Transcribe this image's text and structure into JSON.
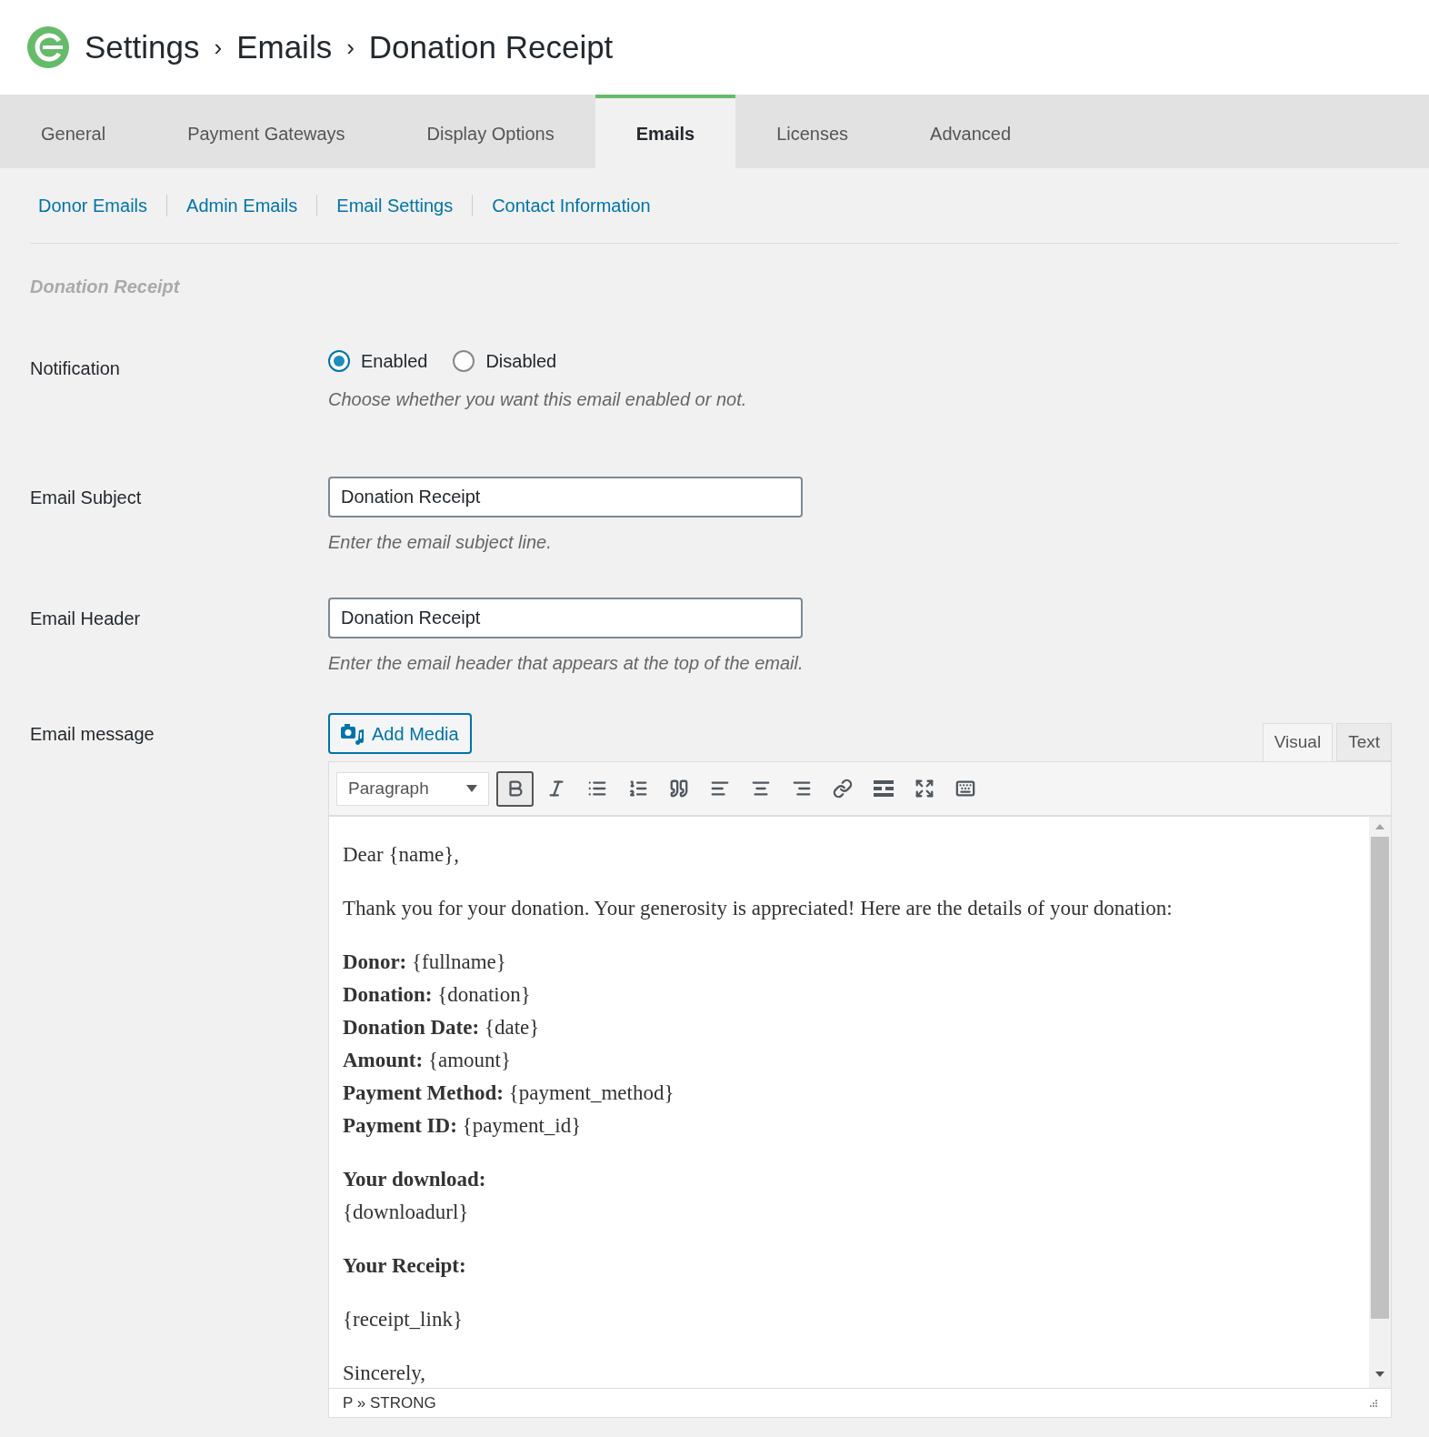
{
  "breadcrumb": [
    "Settings",
    "Emails",
    "Donation Receipt"
  ],
  "breadcrumb_separator": "›",
  "tabs": [
    {
      "label": "General",
      "selected": false
    },
    {
      "label": "Payment Gateways",
      "selected": false
    },
    {
      "label": "Display Options",
      "selected": false
    },
    {
      "label": "Emails",
      "selected": true
    },
    {
      "label": "Licenses",
      "selected": false
    },
    {
      "label": "Advanced",
      "selected": false
    }
  ],
  "subnav": [
    "Donor Emails",
    "Admin Emails",
    "Email Settings",
    "Contact Information"
  ],
  "section_title": "Donation Receipt",
  "notification": {
    "label": "Notification",
    "options": [
      {
        "label": "Enabled",
        "selected": true
      },
      {
        "label": "Disabled",
        "selected": false
      }
    ],
    "help": "Choose whether you want this email enabled or not."
  },
  "subject": {
    "label": "Email Subject",
    "value": "Donation Receipt",
    "help": "Enter the email subject line."
  },
  "header": {
    "label": "Email Header",
    "value": "Donation Receipt",
    "help": "Enter the email header that appears at the top of the email."
  },
  "message": {
    "label": "Email message",
    "add_media": "Add Media",
    "modes": [
      {
        "label": "Visual",
        "selected": true
      },
      {
        "label": "Text",
        "selected": false
      }
    ],
    "format": "Paragraph",
    "toolbar": [
      {
        "pressed": true
      },
      {
        "pressed": false
      },
      {
        "pressed": false
      },
      {
        "pressed": false
      },
      {
        "pressed": false
      },
      {
        "pressed": false
      },
      {
        "pressed": false
      },
      {
        "pressed": false
      },
      {
        "pressed": false
      },
      {
        "pressed": false
      },
      {
        "pressed": false
      },
      {
        "pressed": false
      }
    ],
    "paragraphs": [
      [
        "Dear {name},"
      ],
      [
        "Thank you for your donation. Your generosity is appreciated! Here are the details of your donation:"
      ],
      [
        "**Donor:** {fullname}",
        "**Donation:** {donation}",
        "**Donation Date:** {date}",
        "**Amount:** {amount}",
        "**Payment Method:** {payment_method}",
        "**Payment ID:** {payment_id}"
      ],
      [
        "**Your download:**",
        "{downloadurl}"
      ],
      [
        "**Your Receipt:**"
      ],
      [
        "{receipt_link}"
      ],
      [
        "Sincerely,"
      ]
    ],
    "path": "P » STRONG"
  }
}
